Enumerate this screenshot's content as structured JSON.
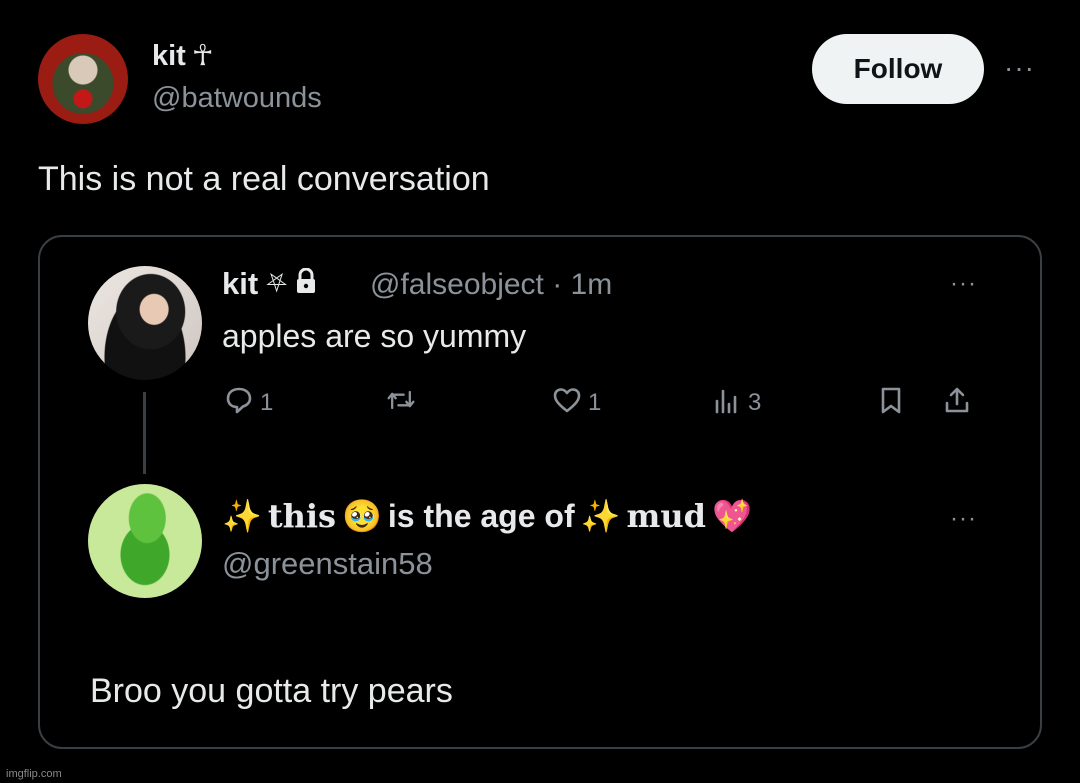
{
  "tweet": {
    "author_name": "kit",
    "author_symbol": "☥",
    "author_handle": "@batwounds",
    "follow_label": "Follow",
    "more_label": "···",
    "text": "This is not a real conversation"
  },
  "quote": {
    "first": {
      "name": "kit",
      "symbol": "⛧",
      "lock": "🔒",
      "handle_time": "@falseobject · 1m",
      "text": "apples are so yummy",
      "more_label": "···",
      "actions": {
        "reply_count": "1",
        "like_count": "1",
        "views_count": "3"
      }
    },
    "second": {
      "name_parts": [
        "✨",
        "this",
        "🥹",
        "is the age of",
        "✨",
        "mud",
        "💖"
      ],
      "handle": "@greenstain58",
      "more_label": "···",
      "text": "Broo you gotta try pears"
    }
  },
  "watermark": "imgflip.com",
  "colors": {
    "background": "#000000",
    "text": "#e7e9ea",
    "muted": "#8b9299",
    "border": "#3a3f44",
    "follow_bg": "#eff3f4"
  },
  "icons": [
    "reply-icon",
    "retweet-icon",
    "like-icon",
    "views-icon",
    "bookmark-icon",
    "share-icon",
    "lock-icon"
  ]
}
